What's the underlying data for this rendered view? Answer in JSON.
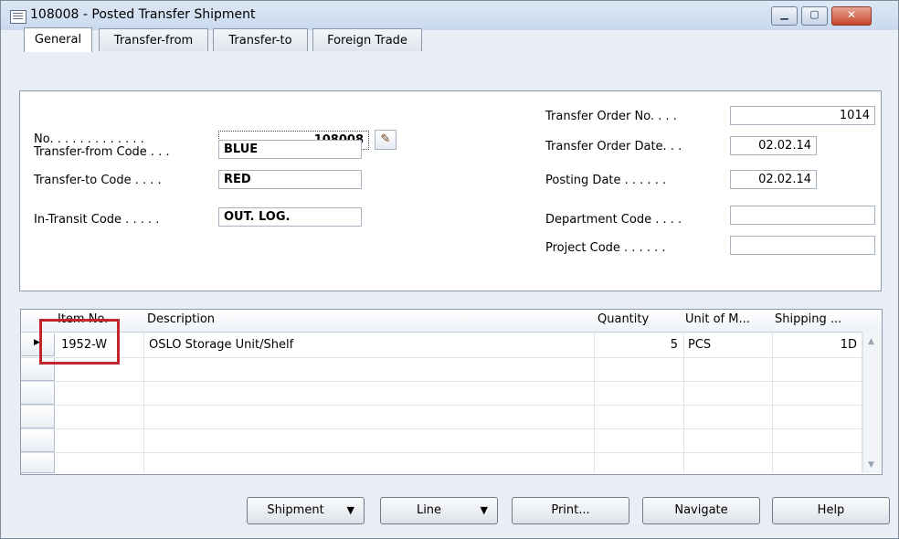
{
  "window": {
    "title": "108008 - Posted Transfer Shipment",
    "controls": {
      "minimize": "▁",
      "maximize": "▢",
      "close": "✕"
    }
  },
  "tabs": [
    {
      "label": "General",
      "active": true
    },
    {
      "label": "Transfer-from",
      "active": false
    },
    {
      "label": "Transfer-to",
      "active": false
    },
    {
      "label": "Foreign Trade",
      "active": false
    }
  ],
  "general": {
    "no": {
      "label": "No. . . . . . . . . . . . .",
      "value": "108008"
    },
    "transfer_from_code": {
      "label": "Transfer-from Code . . .",
      "value": "BLUE"
    },
    "transfer_to_code": {
      "label": "Transfer-to Code . . . .",
      "value": "RED"
    },
    "in_transit_code": {
      "label": "In-Transit Code . . . . .",
      "value": "OUT. LOG."
    },
    "transfer_order_no": {
      "label": "Transfer Order No. . . .",
      "value": "1014"
    },
    "transfer_order_date": {
      "label": "Transfer Order Date. . .",
      "value": "02.02.14"
    },
    "posting_date": {
      "label": "Posting Date . . . . . .",
      "value": "02.02.14"
    },
    "department_code": {
      "label": "Department Code . . . .",
      "value": ""
    },
    "project_code": {
      "label": "Project Code . . . . . .",
      "value": ""
    }
  },
  "lines": {
    "columns": [
      "Item No.",
      "Description",
      "Quantity",
      "Unit of M...",
      "Shipping ..."
    ],
    "rows": [
      {
        "item_no": "1952-W",
        "description": "OSLO Storage Unit/Shelf",
        "quantity": "5",
        "unit": "PCS",
        "shipping": "1D"
      }
    ],
    "row_indicator": "▶"
  },
  "buttons": {
    "shipment": "Shipment",
    "line": "Line",
    "print": "Print...",
    "navigate": "Navigate",
    "help": "Help",
    "dropdown_glyph": "▼"
  },
  "colors": {
    "highlight": "#c0262b"
  }
}
